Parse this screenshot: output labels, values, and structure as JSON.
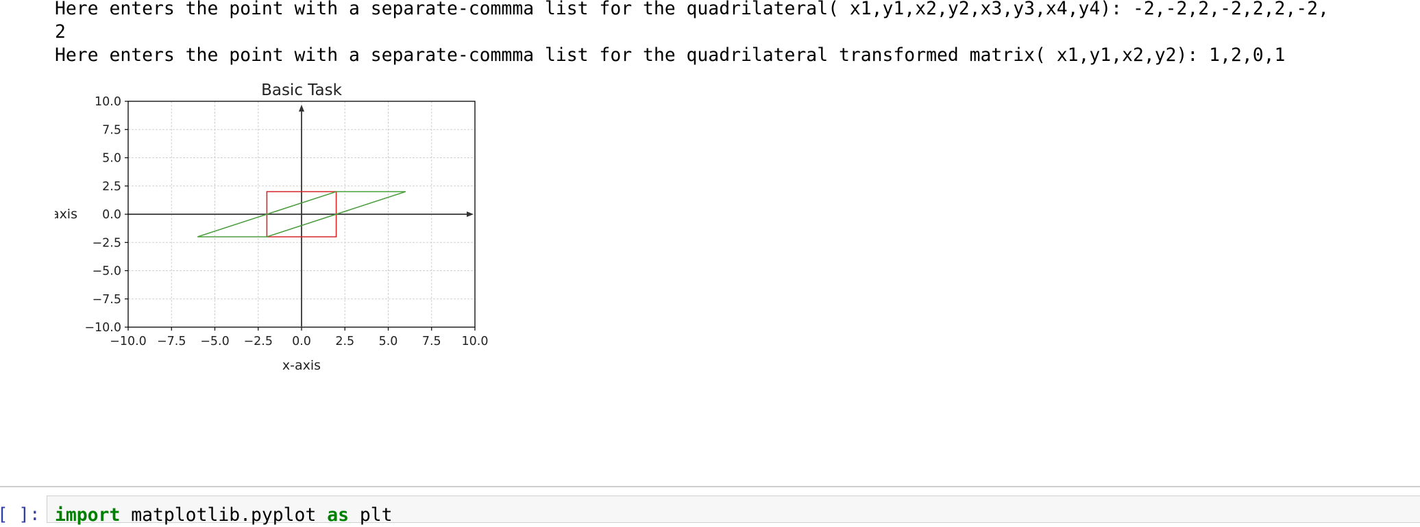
{
  "output": {
    "line1": "Here enters the point with a separate-commma list for the quadrilateral( x1,y1,x2,y2,x3,y3,x4,y4): -2,-2,2,-2,2,2,-2,",
    "line1_wrap": "2",
    "line2": "Here enters the point with a separate-commma list for the quadrilateral transformed matrix( x1,y1,x2,y2): 1,2,0,1"
  },
  "chart_data": {
    "type": "line",
    "title": "Basic Task",
    "xlabel": "x-axis",
    "ylabel": "y-axis",
    "xlim": [
      -10,
      10
    ],
    "ylim": [
      -10,
      10
    ],
    "xticks": [
      -10,
      -7.5,
      -5,
      -2.5,
      0,
      2.5,
      5,
      7.5,
      10
    ],
    "yticks": [
      -10,
      -7.5,
      -5,
      -2.5,
      0,
      2.5,
      5,
      7.5,
      10
    ],
    "xtick_labels": [
      "−10.0",
      "−7.5",
      "−5.0",
      "−2.5",
      "0.0",
      "2.5",
      "5.0",
      "7.5",
      "10.0"
    ],
    "ytick_labels": [
      "−10.0",
      "−7.5",
      "−5.0",
      "−2.5",
      "0.0",
      "2.5",
      "5.0",
      "7.5",
      "10.0"
    ],
    "grid": true,
    "series": [
      {
        "color": "#d62728",
        "x": [
          -2,
          2,
          2,
          -2,
          -2
        ],
        "y": [
          -2,
          -2,
          2,
          2,
          -2
        ]
      },
      {
        "color": "#4c9e3f",
        "x": [
          -6,
          -2,
          6,
          2,
          -6
        ],
        "y": [
          -2,
          -2,
          2,
          2,
          -2
        ]
      }
    ]
  },
  "next_cell": {
    "prompt": "[ ]:",
    "code_keyword": "import",
    "code_module": " matplotlib.pyplot ",
    "code_as": "as",
    "code_alias": " plt"
  }
}
